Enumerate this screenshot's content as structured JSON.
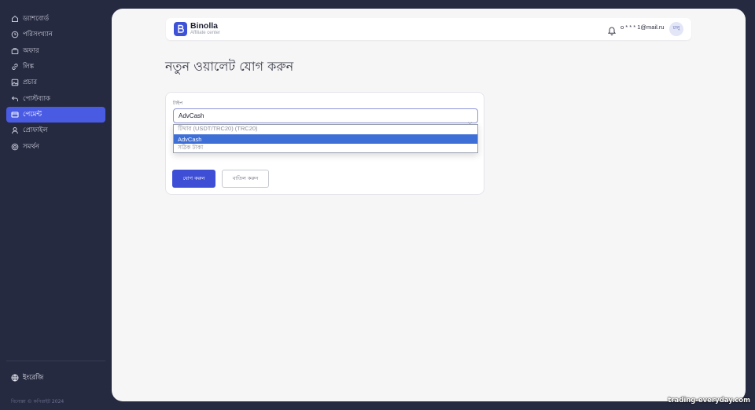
{
  "sidebar": {
    "items": [
      {
        "label": "ড্যাশবোর্ড",
        "icon": "home-icon"
      },
      {
        "label": "পরিসংখ্যান",
        "icon": "clock-icon"
      },
      {
        "label": "অফার",
        "icon": "briefcase-icon"
      },
      {
        "label": "লিঙ্ক",
        "icon": "link-icon"
      },
      {
        "label": "প্রচার",
        "icon": "image-icon"
      },
      {
        "label": "পোস্টব্যাক",
        "icon": "reply-icon"
      },
      {
        "label": "পেমেন্ট",
        "icon": "card-icon",
        "active": true
      },
      {
        "label": "প্রোফাইল",
        "icon": "user-icon"
      },
      {
        "label": "সমর্থন",
        "icon": "lifebuoy-icon"
      }
    ],
    "language": "ইংরেজি",
    "copyright": "বিনোল্লা © কপিরাইট 2024"
  },
  "header": {
    "brand": "Binolla",
    "brand_sub": "Affiliate center",
    "email": "o * * * 1@mail.ru",
    "avatar_text": "চালু"
  },
  "page": {
    "title": "নতুন ওয়ালেট যোগ করুন"
  },
  "form": {
    "type_label": "টাইপ",
    "selected_value": "AdvCash",
    "options": [
      {
        "label": "টিথার (USDT/TRC20) (TRC20)",
        "selected": false
      },
      {
        "label": "AdvCash",
        "selected": true
      },
      {
        "label": "সঠিক টাকা",
        "selected": false
      }
    ],
    "add_button": "যোগ করুন",
    "cancel_button": "বাতিল করুন"
  },
  "watermark": "trading-everyday.com",
  "colors": {
    "sidebar_bg": "#262a41",
    "accent": "#4a5be3",
    "primary_button": "#3e4fd6",
    "dropdown_selected": "#3d6fd6"
  }
}
